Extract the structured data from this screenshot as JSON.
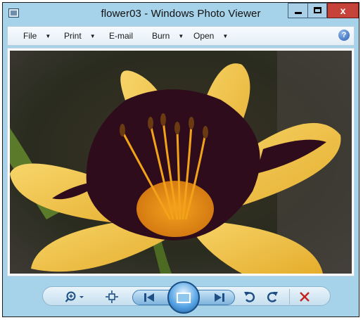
{
  "window": {
    "title": "flower03 - Windows Photo Viewer"
  },
  "menu": {
    "file": "File",
    "print": "Print",
    "email": "E-mail",
    "burn": "Burn",
    "open": "Open",
    "caret": "▼",
    "help": "?"
  },
  "window_controls": {
    "close": "x"
  },
  "image": {
    "alt": "flower03"
  },
  "accent": {
    "blue": "#a6d3ea",
    "close_red": "#c6433a",
    "delete_red": "#c4221e"
  }
}
